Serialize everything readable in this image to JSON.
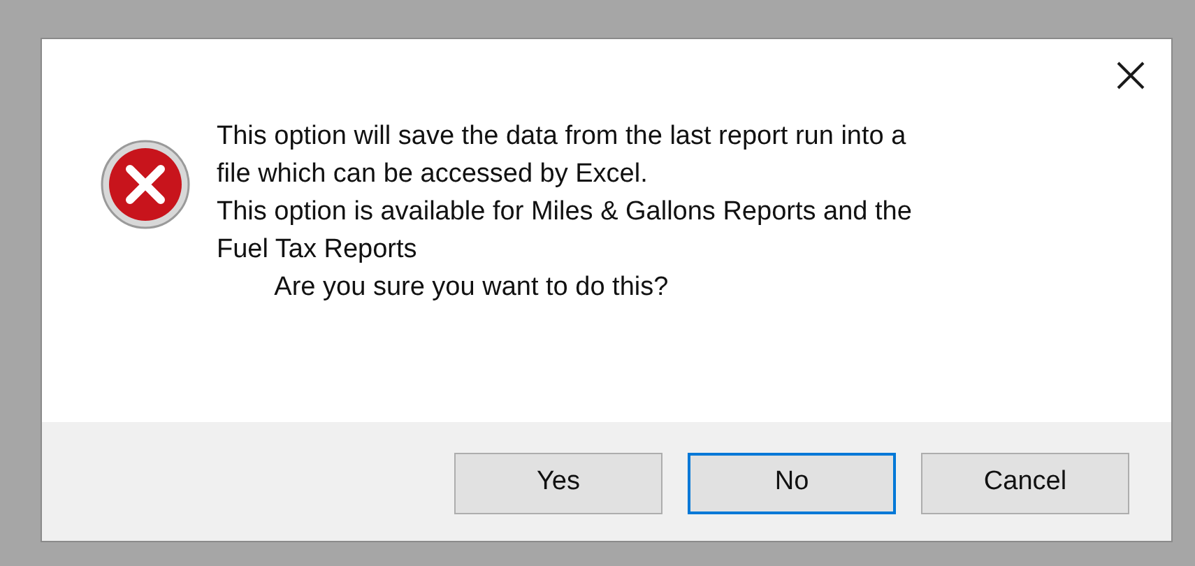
{
  "dialog": {
    "kind": "error",
    "message_lines": [
      "This option will save the data from the last report run into a",
      "file which can be accessed by Excel.",
      "This option is available for Miles & Gallons Reports and the",
      "Fuel Tax Reports",
      "        Are you sure you want to do this?"
    ],
    "buttons": [
      {
        "label": "Yes",
        "default": false
      },
      {
        "label": "No",
        "default": true
      },
      {
        "label": "Cancel",
        "default": false
      }
    ]
  }
}
